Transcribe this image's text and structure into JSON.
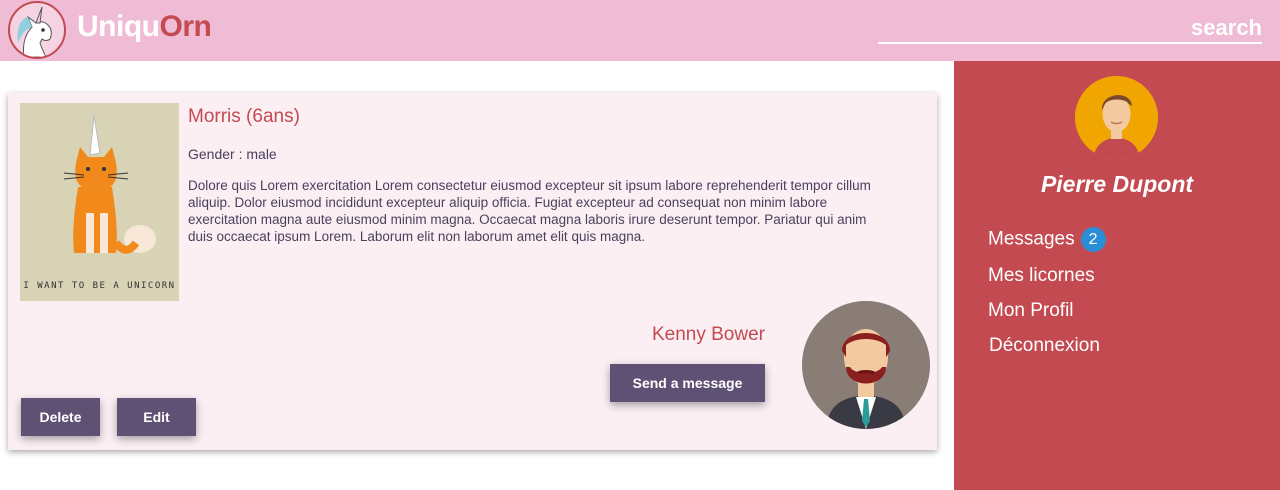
{
  "header": {
    "brand_part1": "Uniqu",
    "brand_part2": "Orn",
    "search_placeholder": "search",
    "logo_icon": "unicorn-logo-icon",
    "background": "#f0bbd4"
  },
  "card": {
    "pet_name": "Morris (6ans)",
    "gender": "Gender : male",
    "description": "Dolore quis Lorem exercitation Lorem consectetur eiusmod excepteur sit ipsum labore reprehenderit tempor cillum aliquip. Dolor eiusmod incididunt excepteur aliquip officia. Fugiat excepteur ad consequat non minim labore exercitation magna aute eiusmod minim magna. Occaecat magna laboris irure deserunt tempor. Pariatur qui anim duis occaecat ipsum Lorem. Laborum elit non laborum amet elit quis magna.",
    "image_caption": "I WANT TO BE A UNICORN",
    "owner_name": "Kenny Bower",
    "send_label": "Send a message",
    "delete_label": "Delete",
    "edit_label": "Edit",
    "background": "#fbeff4"
  },
  "sidebar": {
    "user_name": "Pierre Dupont",
    "nav": {
      "messages": {
        "label": "Messages",
        "badge": "2"
      },
      "licornes": "Mes licornes",
      "profil": "Mon Profil",
      "logout": "Déconnexion"
    },
    "background": "#c44a51",
    "badge_color": "#2a8ed6"
  },
  "colors": {
    "accent": "#c44a51",
    "button": "#5f5173",
    "text": "#4a3f5c"
  }
}
